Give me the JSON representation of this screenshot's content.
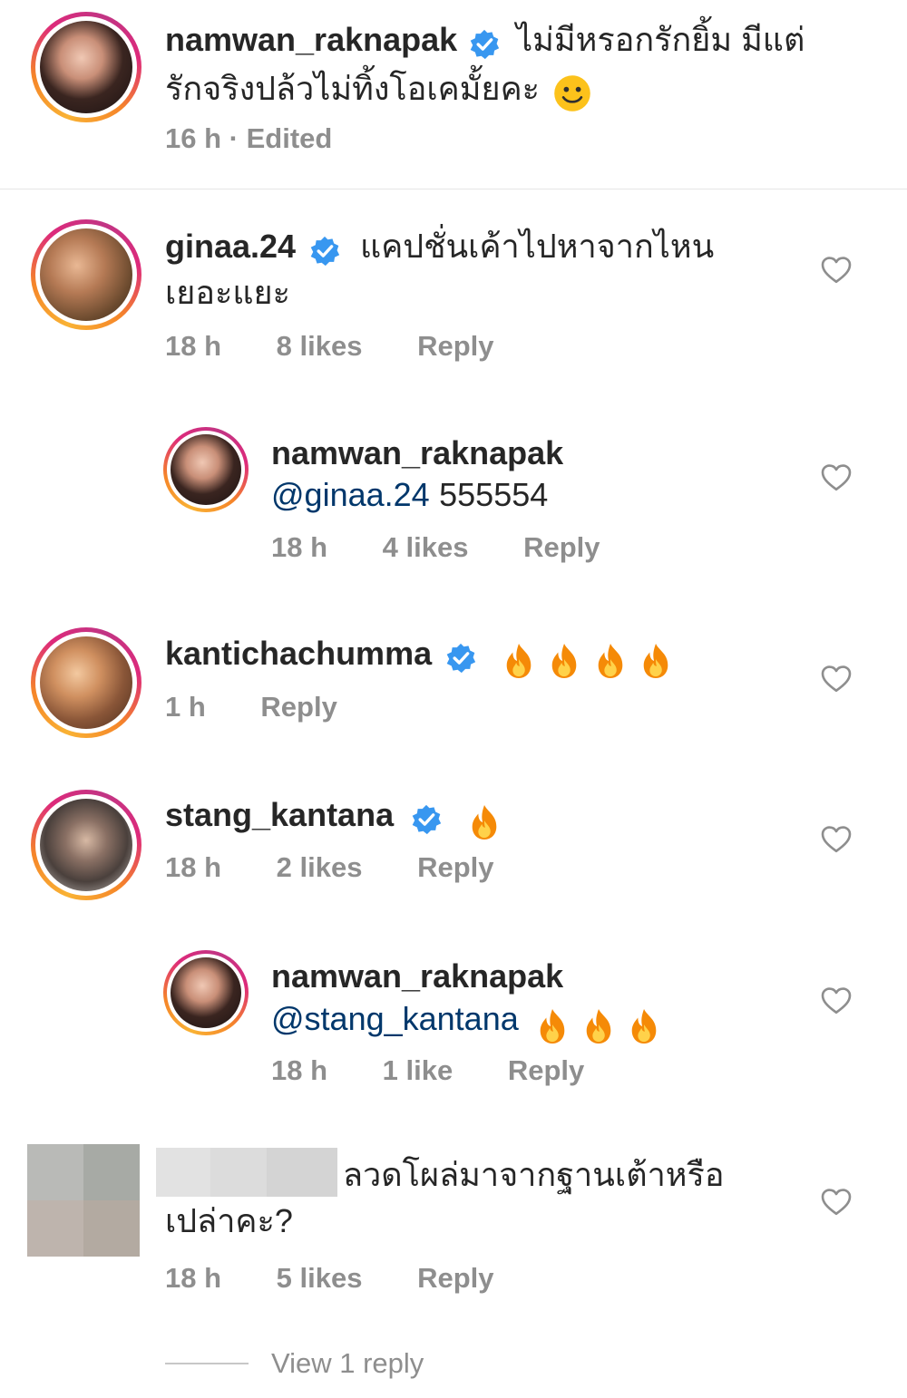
{
  "caption": {
    "username": "namwan_raknapak",
    "text_line1": "ไม่มีหรอกรักยิ้ม มีแต่",
    "text_line2": "รักจริงปล้วไม่ทิ้งโอเคมั้ยคะ",
    "emoji": "smiling-face-emoji",
    "time": "16 h",
    "edited": "· Edited"
  },
  "comments": [
    {
      "username": "ginaa.24",
      "verified": true,
      "text_line1": "แคปชั่นเค้าไปหาจากไหน",
      "text_line2": "เยอะแยะ",
      "time": "18 h",
      "likes": "8 likes",
      "reply_label": "Reply"
    },
    {
      "username": "namwan_raknapak",
      "mention": "@ginaa.24",
      "text": "555554",
      "time": "18 h",
      "likes": "4 likes",
      "reply_label": "Reply"
    },
    {
      "username": "kantichachumma",
      "verified": true,
      "flames": 4,
      "time": "1 h",
      "reply_label": "Reply"
    },
    {
      "username": "stang_kantana",
      "verified": true,
      "flames": 1,
      "time": "18 h",
      "likes": "2 likes",
      "reply_label": "Reply"
    },
    {
      "username": "namwan_raknapak",
      "mention": "@stang_kantana",
      "flames": 3,
      "time": "18 h",
      "likes": "1 like",
      "reply_label": "Reply"
    },
    {
      "username": "",
      "text_line1": "ลวดโผล่มาจากฐานเต้าหรือ",
      "text_line2": "เปล่าคะ?",
      "time": "18 h",
      "likes": "5 likes",
      "reply_label": "Reply"
    }
  ],
  "view_replies": "View 1 reply",
  "colors": {
    "verified_blue": "#3897f0",
    "meta_gray": "#8e8e8e",
    "mention_blue": "#00376b",
    "story_ring": [
      "#f9b234",
      "#dd2a7b",
      "#c13584"
    ]
  },
  "icons": {
    "verified": "verified-badge-icon",
    "heart": "heart-outline-icon",
    "flame": "fire-emoji"
  }
}
